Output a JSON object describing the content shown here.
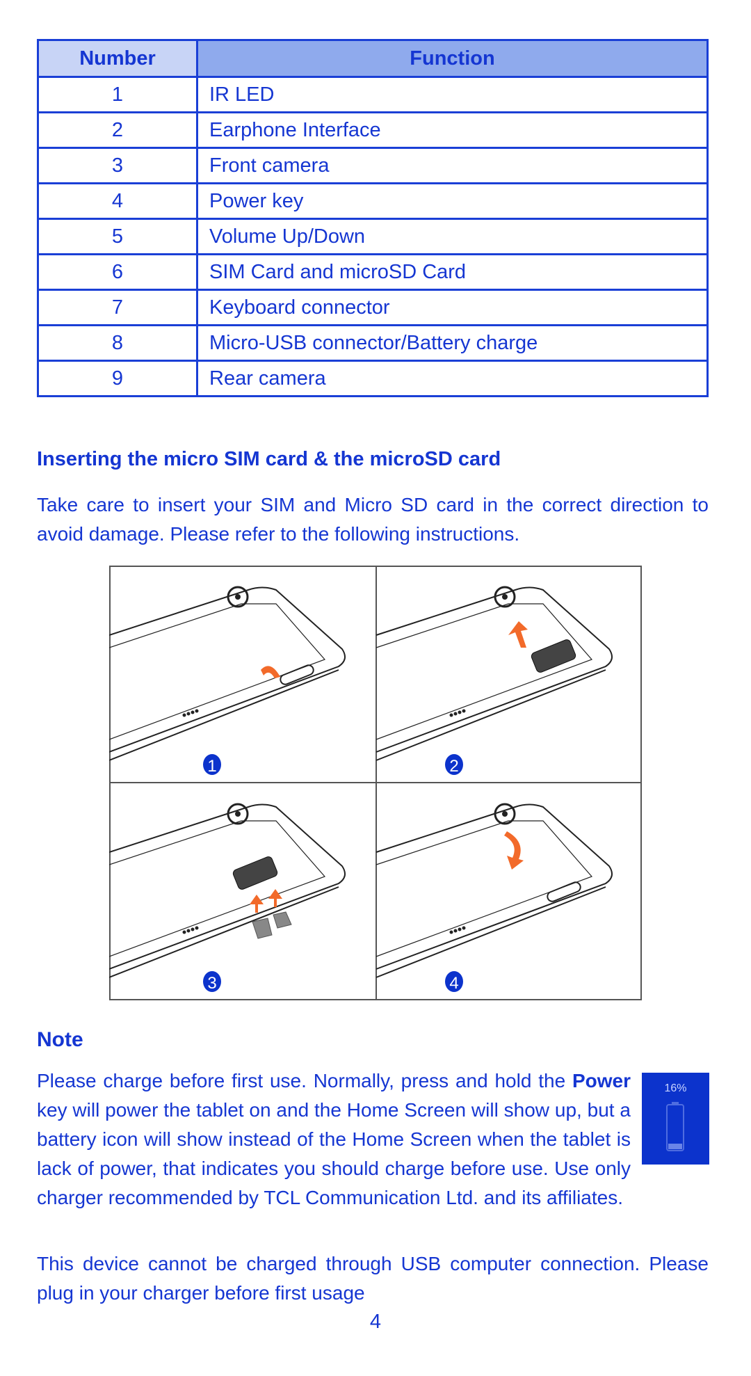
{
  "table": {
    "headers": [
      "Number",
      "Function"
    ],
    "rows": [
      {
        "number": "1",
        "function": "IR LED"
      },
      {
        "number": "2",
        "function": "Earphone Interface"
      },
      {
        "number": "3",
        "function": "Front camera"
      },
      {
        "number": "4",
        "function": "Power key"
      },
      {
        "number": "5",
        "function": "Volume Up/Down"
      },
      {
        "number": "6",
        "function": "SIM Card and microSD Card"
      },
      {
        "number": "7",
        "function": "Keyboard connector"
      },
      {
        "number": "8",
        "function": "Micro-USB connector/Battery charge"
      },
      {
        "number": "9",
        "function": "Rear camera"
      }
    ]
  },
  "section": {
    "title": "Inserting the micro SIM card & the microSD card",
    "body": "Take care to insert your SIM and Micro SD card in the correct direction to avoid damage. Please refer to the following instructions.",
    "steps": [
      "1",
      "2",
      "3",
      "4"
    ]
  },
  "note": {
    "title": "Note",
    "p1_a": "Please charge before first use. Normally, press and hold the ",
    "p1_bold": "Power",
    "p1_b": " key will power the tablet on and the Home Screen will show up, but a battery icon will show instead of the Home Screen when the tablet is lack of power, that indicates you should charge before use. Use only charger recommended by TCL Communication Ltd. and its affiliates.",
    "battery_label": "16%",
    "p2": "This device cannot be charged through USB computer connection. Please plug in your charger before first usage"
  },
  "page_number": "4",
  "colors": {
    "text": "#1536d2",
    "header_number_bg": "#c8d4f6",
    "header_function_bg": "#8faaed",
    "arrow": "#f26a2a",
    "battery_bg": "#0c33cc"
  }
}
